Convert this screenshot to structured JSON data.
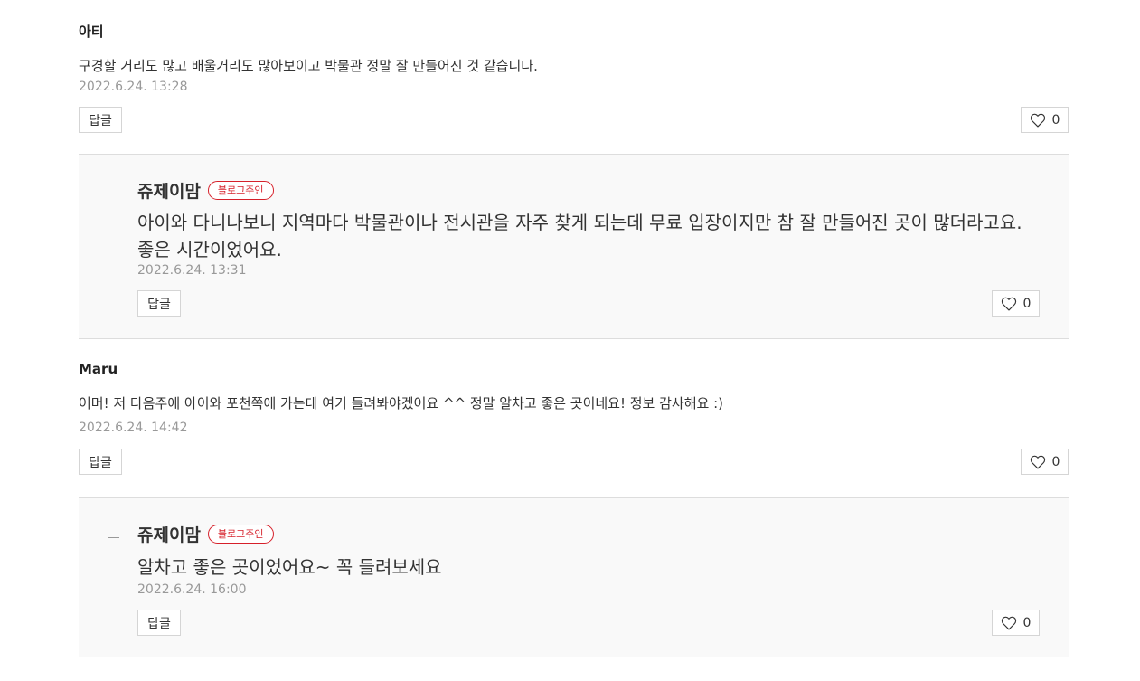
{
  "comments": [
    {
      "author": "아티",
      "text": "구경할 거리도 많고 배울거리도 많아보이고 박물관 정말 잘 만들어진 것 같습니다.",
      "date": "2022.6.24. 13:28",
      "reply_label": "답글",
      "likes": "0",
      "replies": [
        {
          "author": "쥬제이맘",
          "badge": "블로그주인",
          "text": "아이와 다니나보니 지역마다 박물관이나 전시관을 자주 찾게 되는데 무료 입장이지만 참 잘 만들어진 곳이 많더라고요. 좋은 시간이었어요.",
          "date": "2022.6.24. 13:31",
          "reply_label": "답글",
          "likes": "0"
        }
      ]
    },
    {
      "author": "Maru",
      "text": "어머! 저 다음주에 아이와 포천쪽에 가는데 여기 들려봐야겠어요 ^^ 정말 알차고 좋은 곳이네요! 정보 감사해요 :)",
      "date": "2022.6.24. 14:42",
      "reply_label": "답글",
      "likes": "0",
      "replies": [
        {
          "author": "쥬제이맘",
          "badge": "블로그주인",
          "text": "알차고 좋은 곳이었어요~ 꼭 들려보세요",
          "date": "2022.6.24. 16:00",
          "reply_label": "답글",
          "likes": "0"
        }
      ]
    }
  ],
  "icons": {
    "like": "heart-outline-icon",
    "reply_marker": "reply-corner-icon"
  },
  "colors": {
    "badge": "#d6202a",
    "date": "#999999",
    "reply_bg": "#f9f9f9"
  }
}
